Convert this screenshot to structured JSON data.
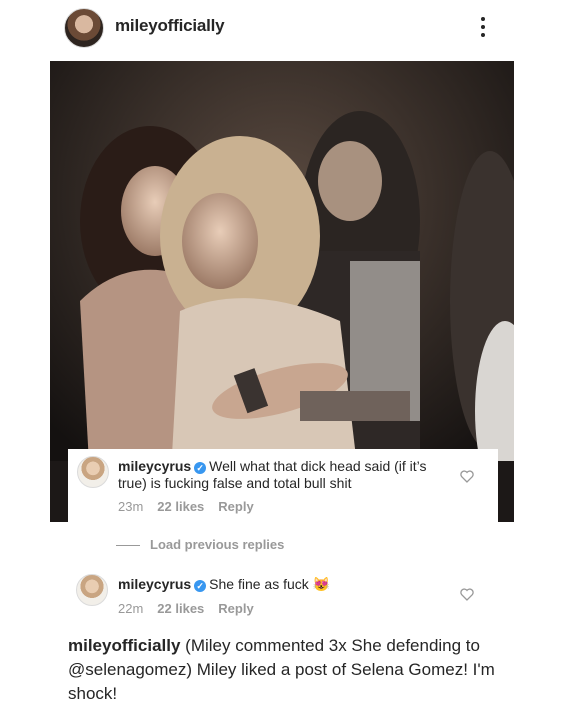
{
  "post": {
    "username": "mileyofficially"
  },
  "comments": [
    {
      "username": "mileycyrus",
      "text": "Well what that dick head said (if it’s true) is fucking false and total bull shit",
      "time": "23m",
      "likes": "22 likes",
      "reply_label": "Reply"
    },
    {
      "username": "mileycyrus",
      "text": "She  fine as fuck",
      "emoji": "😻",
      "time": "22m",
      "likes": "22 likes",
      "reply_label": "Reply"
    }
  ],
  "load_previous": "Load previous replies",
  "caption": {
    "username": "mileyofficially",
    "text": " (Miley commented 3x She defending to @selenagomez)  Miley liked a post of Selena Gomez! I'm shock!"
  },
  "colors": {
    "verified": "#3897f0",
    "meta": "#999999",
    "text": "#262626"
  }
}
